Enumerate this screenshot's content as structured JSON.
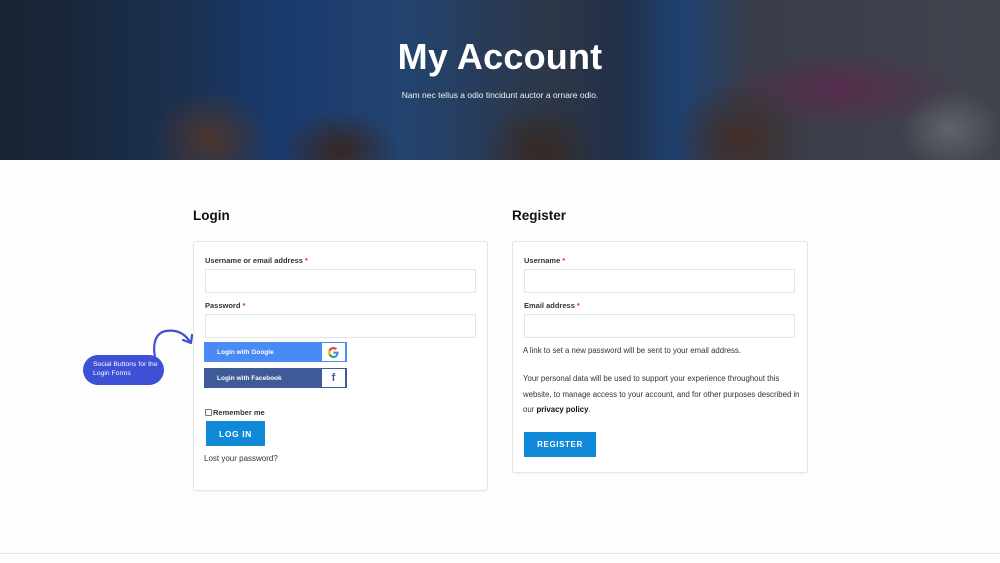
{
  "hero": {
    "title": "My Account",
    "subtitle": "Nam nec tellus a odio tincidunt auctor a ornare odio."
  },
  "login": {
    "title": "Login",
    "username_label": "Username or email address",
    "username_value": "",
    "password_label": "Password",
    "password_value": "",
    "required_mark": "*",
    "google_button": "Login with Google",
    "google_icon_glyph": "G",
    "facebook_button": "Login with Facebook",
    "facebook_icon_glyph": "f",
    "remember_label": "Remember me",
    "remember_checked": false,
    "submit_label": "LOG IN",
    "lost_password": "Lost your password?"
  },
  "register": {
    "title": "Register",
    "username_label": "Username",
    "username_value": "",
    "email_label": "Email address",
    "email_value": "",
    "required_mark": "*",
    "info_text": "A link to set a new password will be sent to your email address.",
    "privacy_text_before": "Your personal data will be used to support your experience throughout this website, to manage access to your account, and for other purposes described in our ",
    "privacy_link": "privacy policy",
    "privacy_text_after": ".",
    "submit_label": "REGISTER"
  },
  "annotation": {
    "text": "Social Buttons for the Login Forms"
  },
  "colors": {
    "primary": "#0f89d8",
    "google": "#4a8af4",
    "facebook": "#3f5a98",
    "annotation": "#3d50d6",
    "required": "#e2342d"
  }
}
